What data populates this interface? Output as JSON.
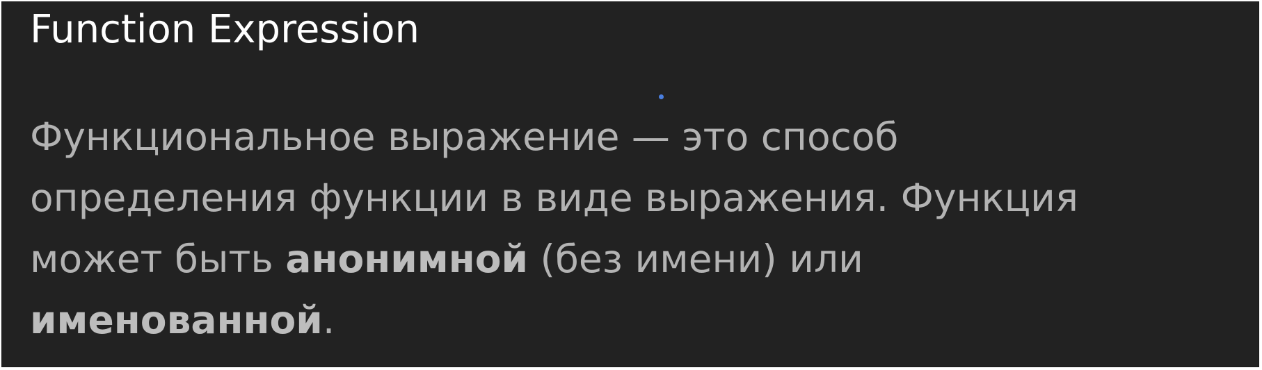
{
  "slide": {
    "title": "Function Expression",
    "lines": [
      {
        "text": "Функциональное выражение — это способ"
      },
      {
        "text": "определения функции в виде выражения. Функция"
      },
      {
        "pre": "может быть ",
        "bold": "анонимной",
        "post": " (без имени) или"
      },
      {
        "bold": "именованной",
        "post": "."
      }
    ]
  },
  "colors": {
    "background": "#222222",
    "title": "#ffffff",
    "body": "#b3b3b3",
    "cursor_dot": "#4a7fe0"
  }
}
